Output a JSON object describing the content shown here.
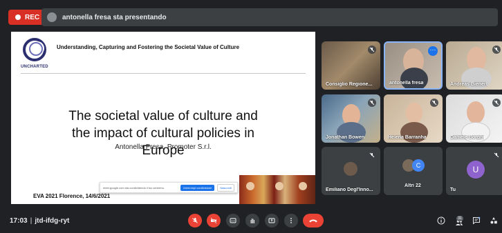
{
  "top_bar": {
    "rec_label": "REC",
    "presenting_text": "antonella fresa sta presentando"
  },
  "slide": {
    "logo_text": "UNCHARTED",
    "header": "Understanding, Capturing and Fostering the Societal Value of Culture",
    "title_lines": [
      "The societal value of culture and",
      "the impact of cultural policies in",
      "Europe"
    ],
    "author": "Antonella Fresa, Promoter S.r.l.",
    "footer": "EVA 2021 Florence, 14/6/2021",
    "share_popup": {
      "message": "meet.google.com sta condividendo il tuo schermo.",
      "stop_label": "Interrompi condivisione",
      "hide_label": "Nascondi"
    }
  },
  "participants": [
    {
      "name": "Consiglio Regione...",
      "muted": true
    },
    {
      "name": "antonella fresa",
      "muted": false,
      "active": true
    },
    {
      "name": "Andreas Bienert",
      "muted": true
    },
    {
      "name": "Jonathan Bowen",
      "muted": true
    },
    {
      "name": "Helena Barranha",
      "muted": true
    },
    {
      "name": "Daniele Borghi",
      "muted": true
    },
    {
      "name": "Emiliano Degl'Inno...",
      "muted": true
    },
    {
      "name": "Altri 22",
      "muted": false
    },
    {
      "name": "Tu",
      "muted": true
    }
  ],
  "avatars": {
    "others_initial": "C",
    "you_initial": "U"
  },
  "bottom_bar": {
    "time": "17:03",
    "separator": "|",
    "meeting_code": "jtd-ifdg-ryt",
    "participant_count": "31"
  },
  "colors": {
    "bar_bg": "#202124",
    "tile_bg": "#3c4043",
    "rec_red": "#d93025",
    "control_red": "#ea4335",
    "active_border": "#8ab4f8",
    "avatar_purple": "#8e63ce",
    "avatar_blue": "#4285f4"
  },
  "icons": [
    "mic-off-icon",
    "camera-off-icon",
    "captions-icon",
    "raise-hand-icon",
    "present-icon",
    "more-options-icon",
    "end-call-icon",
    "info-icon",
    "people-icon",
    "chat-icon",
    "activities-icon"
  ]
}
